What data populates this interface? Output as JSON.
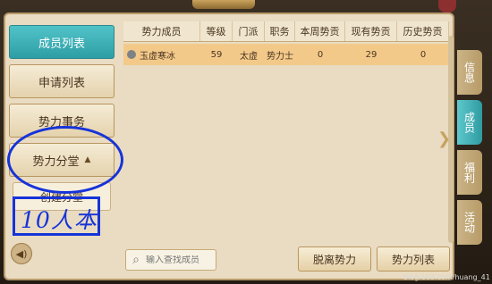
{
  "sidebar": {
    "items": [
      {
        "label": "成员列表",
        "active": true
      },
      {
        "label": "申请列表",
        "active": false
      },
      {
        "label": "势力事务",
        "active": false
      },
      {
        "label": "势力分堂",
        "active": false
      }
    ],
    "expanded_item_caret": "▲",
    "sub_items": [
      {
        "label": "创建分堂"
      }
    ]
  },
  "annotation": {
    "text": "10人本",
    "color": "#1633d9"
  },
  "table": {
    "headers": [
      "势力成员",
      "等级",
      "门派",
      "职务",
      "本周势贡",
      "现有势贡",
      "历史势贡"
    ],
    "rows": [
      {
        "cells": [
          "玉虚寒冰",
          "59",
          "太虚",
          "势力士",
          "0",
          "29",
          "0"
        ]
      }
    ]
  },
  "search": {
    "placeholder": "输入查找成员",
    "value": ""
  },
  "footer": {
    "leave_label": "脱离势力",
    "list_label": "势力列表"
  },
  "right_tabs": [
    {
      "label": "信息",
      "active": false
    },
    {
      "label": "成员",
      "active": true
    },
    {
      "label": "福利",
      "active": false
    },
    {
      "label": "活动",
      "active": false
    }
  ],
  "icons": {
    "volume": "volume-icon",
    "search": "search-icon",
    "arrow": "chevron-right-icon"
  },
  "watermark": "blog.163.com/huang_41",
  "colors": {
    "accent": "#2e9ea5",
    "row_highlight": "#f3c98a",
    "annotation": "#1633d9"
  }
}
